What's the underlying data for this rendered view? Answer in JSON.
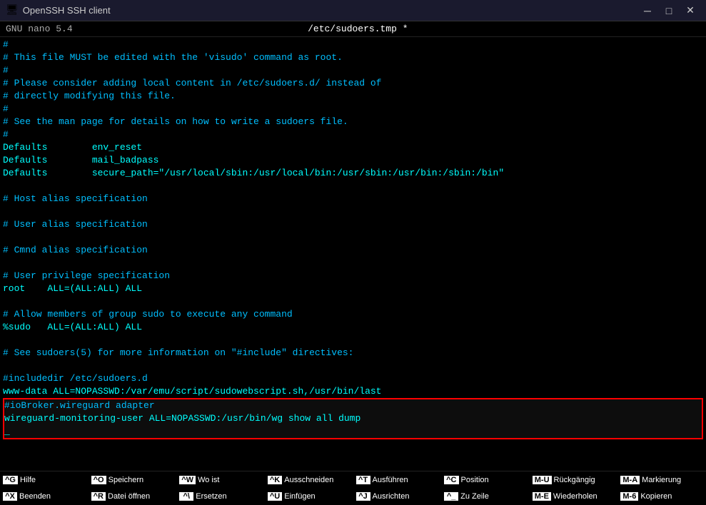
{
  "titlebar": {
    "icon": "🖥",
    "title": "OpenSSH SSH client",
    "minimize": "─",
    "maximize": "□",
    "close": "✕"
  },
  "nano_header": {
    "left": "GNU nano 5.4",
    "center": "/etc/sudoers.tmp *"
  },
  "editor": {
    "lines": [
      {
        "text": "#",
        "type": "comment"
      },
      {
        "text": "# This file MUST be edited with the 'visudo' command as root.",
        "type": "comment"
      },
      {
        "text": "#",
        "type": "comment"
      },
      {
        "text": "# Please consider adding local content in /etc/sudoers.d/ instead of",
        "type": "comment"
      },
      {
        "text": "# directly modifying this file.",
        "type": "comment"
      },
      {
        "text": "#",
        "type": "comment"
      },
      {
        "text": "# See the man page for details on how to write a sudoers file.",
        "type": "comment"
      },
      {
        "text": "#",
        "type": "comment"
      },
      {
        "text": "Defaults        env_reset",
        "type": "normal"
      },
      {
        "text": "Defaults        mail_badpass",
        "type": "normal"
      },
      {
        "text": "Defaults        secure_path=\"/usr/local/sbin:/usr/local/bin:/usr/sbin:/usr/bin:/sbin:/bin\"",
        "type": "normal"
      },
      {
        "text": "",
        "type": "normal"
      },
      {
        "text": "# Host alias specification",
        "type": "comment"
      },
      {
        "text": "",
        "type": "normal"
      },
      {
        "text": "# User alias specification",
        "type": "comment"
      },
      {
        "text": "",
        "type": "normal"
      },
      {
        "text": "# Cmnd alias specification",
        "type": "comment"
      },
      {
        "text": "",
        "type": "normal"
      },
      {
        "text": "# User privilege specification",
        "type": "comment"
      },
      {
        "text": "root    ALL=(ALL:ALL) ALL",
        "type": "normal"
      },
      {
        "text": "",
        "type": "normal"
      },
      {
        "text": "# Allow members of group sudo to execute any command",
        "type": "comment"
      },
      {
        "text": "%sudo   ALL=(ALL:ALL) ALL",
        "type": "normal"
      },
      {
        "text": "",
        "type": "normal"
      },
      {
        "text": "# See sudoers(5) for more information on \"#include\" directives:",
        "type": "comment"
      },
      {
        "text": "",
        "type": "normal"
      },
      {
        "text": "#includedir /etc/sudoers.d",
        "type": "comment"
      },
      {
        "text": "www-data ALL=NOPASSWD:/var/emu/script/sudowebscript.sh,/usr/bin/last",
        "type": "normal"
      }
    ],
    "highlighted_lines": [
      {
        "text": "#ioBroker.wireguard adapter",
        "type": "comment"
      },
      {
        "text": "wireguard-monitoring-user ALL=NOPASSWD:/usr/bin/wg show all dump",
        "type": "normal"
      },
      {
        "text": "_",
        "type": "cursor"
      }
    ]
  },
  "footer": {
    "items": [
      {
        "key": "^G",
        "label": "Hilfe"
      },
      {
        "key": "^O",
        "label": "Speichern"
      },
      {
        "key": "^W",
        "label": "Wo ist"
      },
      {
        "key": "^K",
        "label": "Ausschneiden"
      },
      {
        "key": "^T",
        "label": "Ausführen"
      },
      {
        "key": "^C",
        "label": "Position"
      },
      {
        "key": "M-U",
        "label": "Rückgängig"
      },
      {
        "key": "M-A",
        "label": "Markierung"
      },
      {
        "key": "^X",
        "label": "Beenden"
      },
      {
        "key": "^R",
        "label": "Datei öffnen"
      },
      {
        "key": "^\\",
        "label": "Ersetzen"
      },
      {
        "key": "^U",
        "label": "Einfügen"
      },
      {
        "key": "^J",
        "label": "Ausrichten"
      },
      {
        "key": "^_",
        "label": "Zu Zeile"
      },
      {
        "key": "M-E",
        "label": "Wiederholen"
      },
      {
        "key": "M-6",
        "label": "Kopieren"
      }
    ]
  }
}
